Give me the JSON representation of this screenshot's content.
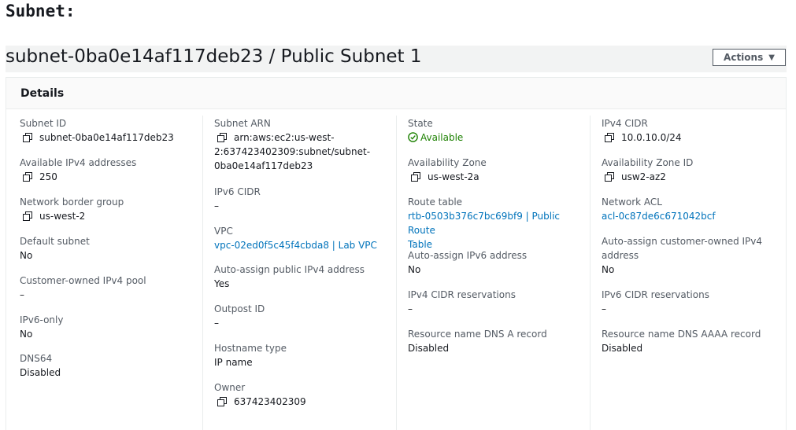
{
  "heading": "Subnet:",
  "page_title": "subnet-0ba0e14af117deb23 / Public Subnet 1",
  "actions_label": "Actions",
  "details_title": "Details",
  "colors": {
    "link": "#0073bb",
    "success": "#1d8102",
    "label": "#545b64"
  },
  "col1": {
    "subnet_id": {
      "label": "Subnet ID",
      "value": "subnet-0ba0e14af117deb23"
    },
    "available_ipv4": {
      "label": "Available IPv4 addresses",
      "value": "250"
    },
    "border_group": {
      "label": "Network border group",
      "value": "us-west-2"
    },
    "default_subnet": {
      "label": "Default subnet",
      "value": "No"
    },
    "customer_pool": {
      "label": "Customer-owned IPv4 pool",
      "value": "–"
    },
    "ipv6_only": {
      "label": "IPv6-only",
      "value": "No"
    },
    "dns64": {
      "label": "DNS64",
      "value": "Disabled"
    }
  },
  "col2": {
    "subnet_arn": {
      "label": "Subnet ARN",
      "line1": "arn:aws:ec2:us-west-",
      "line2": "2:637423402309:subnet/subnet-",
      "line3": "0ba0e14af117deb23"
    },
    "ipv6_cidr": {
      "label": "IPv6 CIDR",
      "value": "–"
    },
    "vpc": {
      "label": "VPC",
      "value": "vpc-02ed0f5c45f4cbda8 | Lab VPC"
    },
    "auto_public_ipv4": {
      "label": "Auto-assign public IPv4 address",
      "value": "Yes"
    },
    "outpost": {
      "label": "Outpost ID",
      "value": "–"
    },
    "hostname_type": {
      "label": "Hostname type",
      "value": "IP name"
    },
    "owner": {
      "label": "Owner",
      "value": "637423402309"
    }
  },
  "col3": {
    "state": {
      "label": "State",
      "value": "Available"
    },
    "az": {
      "label": "Availability Zone",
      "value": "us-west-2a"
    },
    "route_table": {
      "label": "Route table",
      "line1": "rtb-0503b376c7bc69bf9 | Public Route",
      "line2": "Table"
    },
    "auto_ipv6": {
      "label": "Auto-assign IPv6 address",
      "value": "No"
    },
    "ipv4_reservations": {
      "label": "IPv4 CIDR reservations",
      "value": "–"
    },
    "dns_a": {
      "label": "Resource name DNS A record",
      "value": "Disabled"
    }
  },
  "col4": {
    "ipv4_cidr": {
      "label": "IPv4 CIDR",
      "value": "10.0.10.0/24"
    },
    "az_id": {
      "label": "Availability Zone ID",
      "value": "usw2-az2"
    },
    "network_acl": {
      "label": "Network ACL",
      "value": "acl-0c87de6c671042bcf"
    },
    "auto_customer_ipv4": {
      "label_line1": "Auto-assign customer-owned IPv4",
      "label_line2": "address",
      "value": "No"
    },
    "ipv6_reservations": {
      "label": "IPv6 CIDR reservations",
      "value": "–"
    },
    "dns_aaaa": {
      "label": "Resource name DNS AAAA record",
      "value": "Disabled"
    }
  }
}
